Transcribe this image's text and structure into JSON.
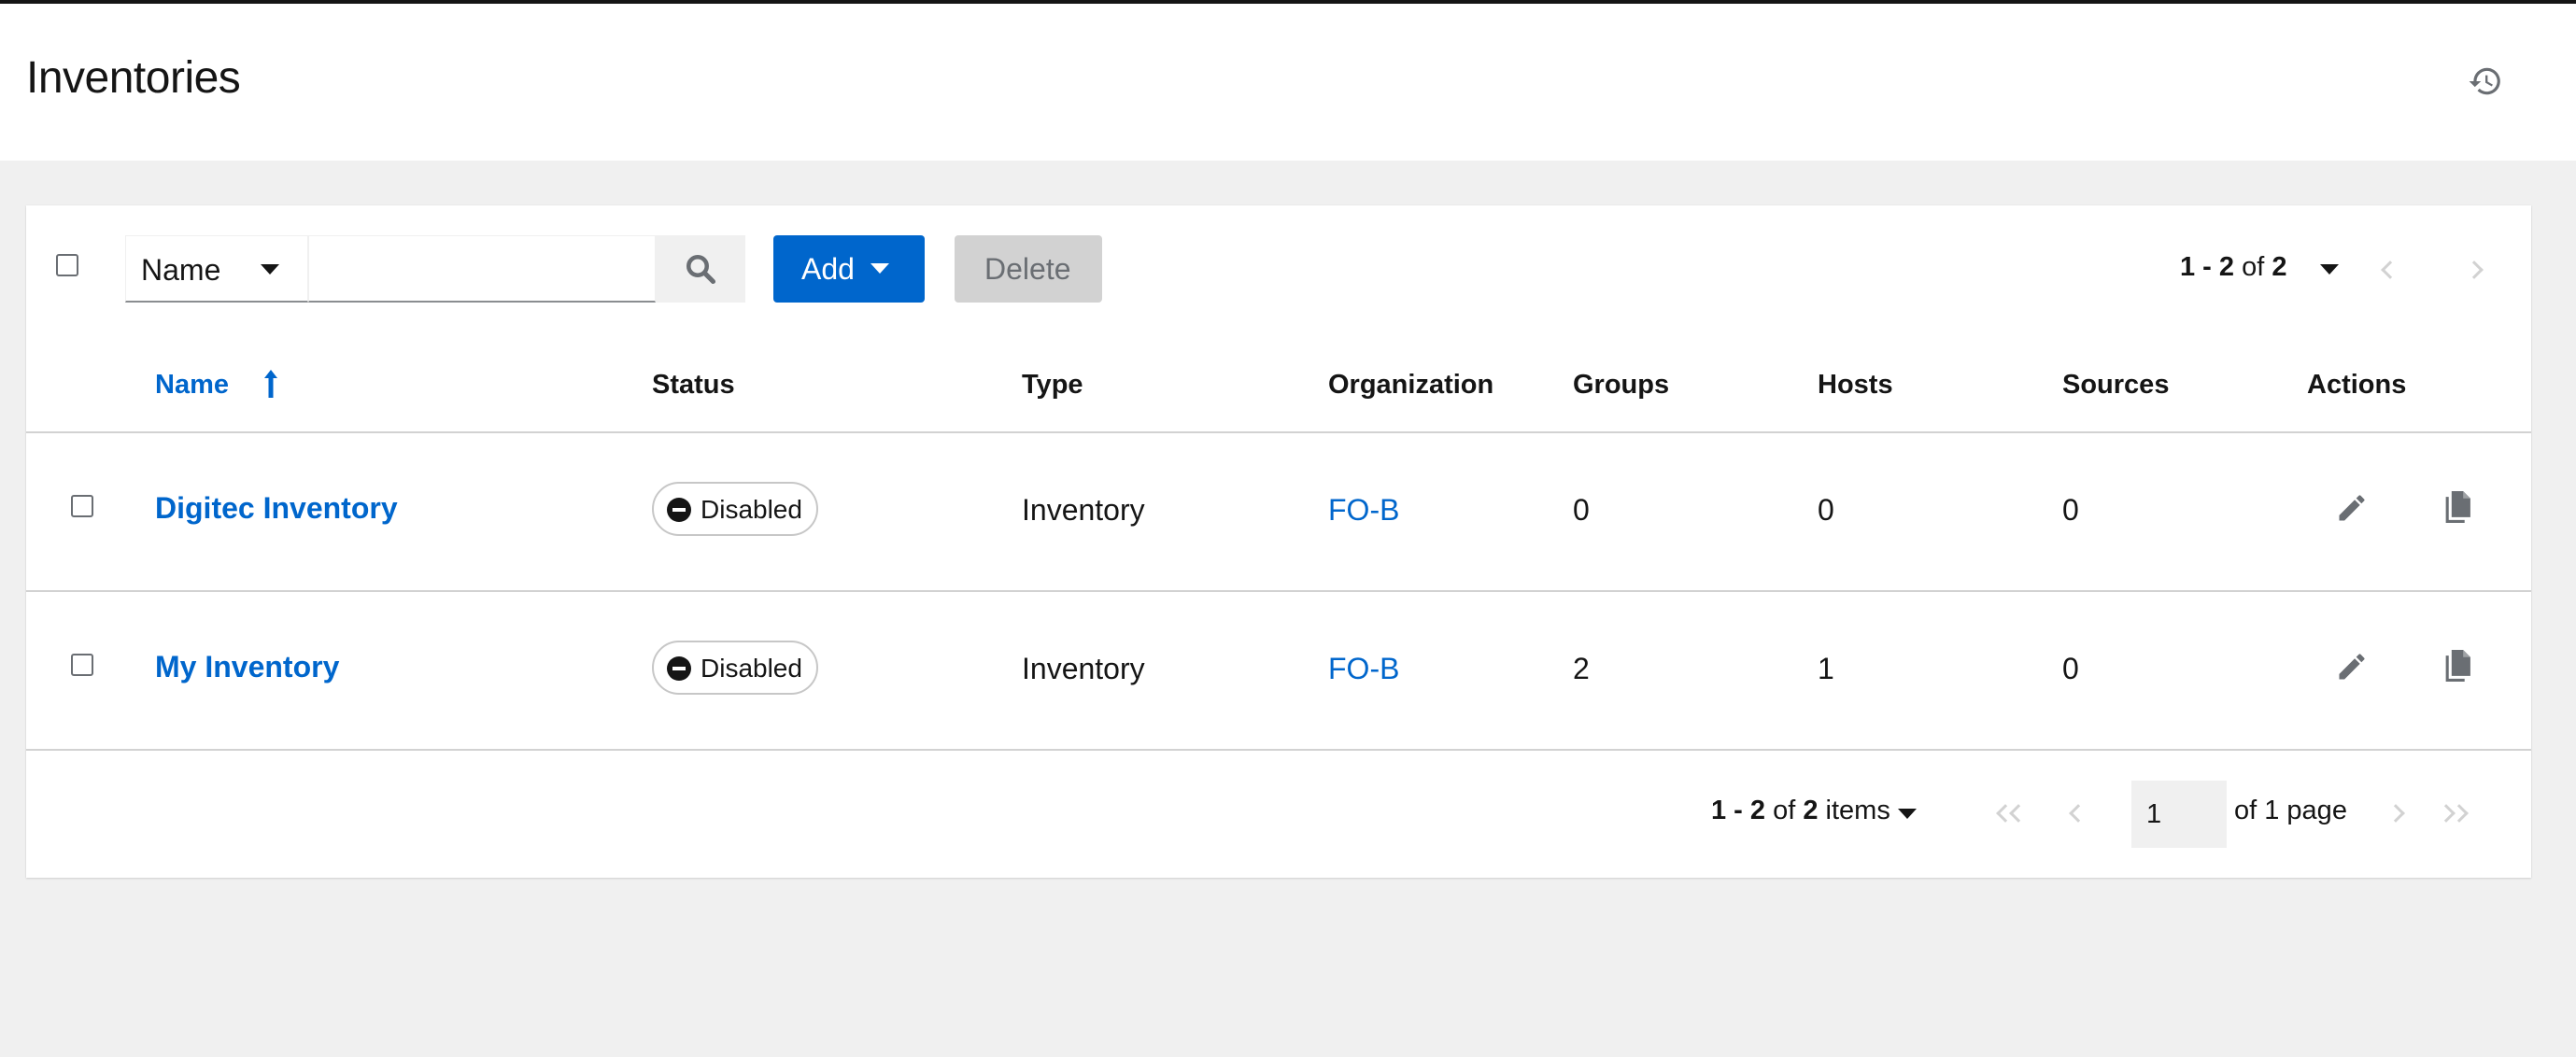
{
  "header": {
    "title": "Inventories",
    "history_icon": "history-icon"
  },
  "toolbar": {
    "filter_field": "Name",
    "search_value": "",
    "add_label": "Add",
    "delete_label": "Delete",
    "pagination_top": {
      "range": "1 - 2",
      "of_word": "of",
      "total": "2"
    }
  },
  "table": {
    "columns": [
      "Name",
      "Status",
      "Type",
      "Organization",
      "Groups",
      "Hosts",
      "Sources",
      "Actions"
    ],
    "sorted_column": "Name",
    "sort_direction": "ascending",
    "rows": [
      {
        "name": "Digitec Inventory",
        "status": "Disabled",
        "type": "Inventory",
        "organization": "FO-B",
        "groups": "0",
        "hosts": "0",
        "sources": "0"
      },
      {
        "name": "My Inventory",
        "status": "Disabled",
        "type": "Inventory",
        "organization": "FO-B",
        "groups": "2",
        "hosts": "1",
        "sources": "0"
      }
    ]
  },
  "pagination_bottom": {
    "range": "1 - 2",
    "of_word": "of",
    "total": "2",
    "items_word": "items",
    "current_page": "1",
    "of_pages": "of 1 page"
  },
  "colors": {
    "link": "#0066cc",
    "primary_button": "#0066cc",
    "disabled_button": "#d2d2d2",
    "page_bg": "#f0f0f0"
  }
}
